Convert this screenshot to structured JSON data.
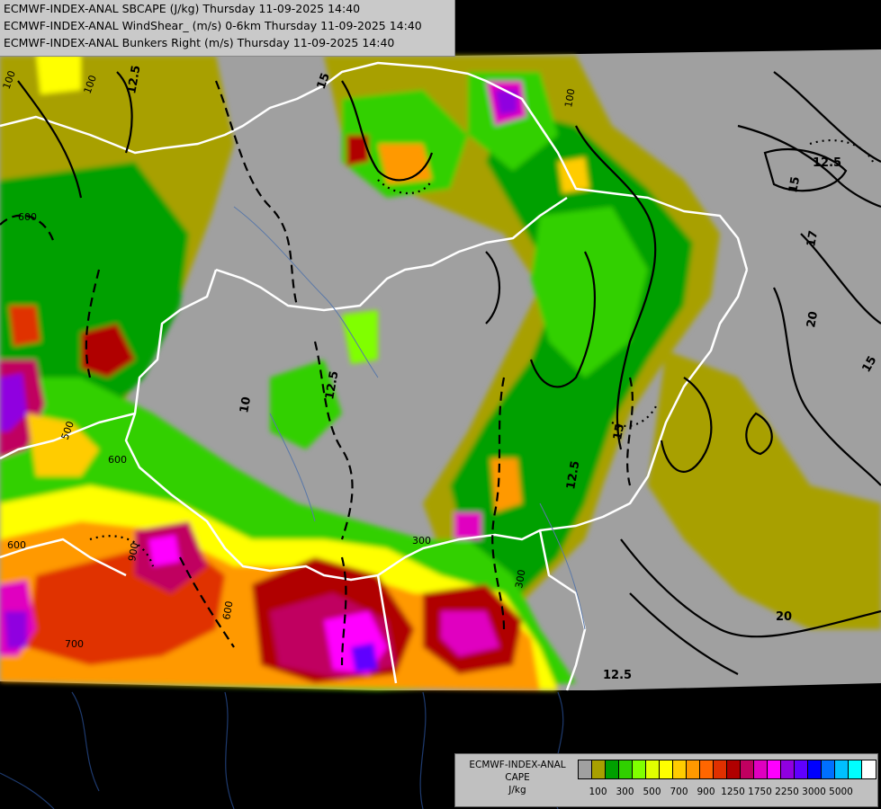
{
  "header": {
    "line1": "ECMWF-INDEX-ANAL SBCAPE (J/kg) Thursday 11-09-2025 14:40",
    "line2": "ECMWF-INDEX-ANAL WindShear_ (m/s) 0-6km Thursday 11-09-2025 14:40",
    "line3": "ECMWF-INDEX-ANAL Bunkers Right (m/s) Thursday 11-09-2025 14:40"
  },
  "legend": {
    "title": "ECMWF-INDEX-ANAL",
    "variable": "CAPE",
    "unit": "J/kg",
    "colors": [
      "#a0a0a0",
      "#a8a000",
      "#00a000",
      "#30d000",
      "#80ff00",
      "#e0ff00",
      "#ffff00",
      "#ffcc00",
      "#ff9900",
      "#ff6600",
      "#e03000",
      "#b00000",
      "#c00060",
      "#e000c0",
      "#ff00ff",
      "#9000e0",
      "#6000ff",
      "#0000ff",
      "#0070ff",
      "#00c0ff",
      "#00ffff",
      "#ffffff"
    ],
    "labels": [
      "100",
      "300",
      "500",
      "700",
      "900",
      "1250",
      "1750",
      "2250",
      "3000",
      "5000"
    ]
  },
  "map_labels": {
    "c1": "100",
    "c2": "12.5",
    "c3": "10",
    "c4": "15",
    "c5": "17",
    "c6": "20",
    "c7": "300",
    "c8": "500",
    "c9": "600",
    "c10": "700",
    "c11": "900",
    "c12": "12.5",
    "c13": "20",
    "c14": "15"
  }
}
